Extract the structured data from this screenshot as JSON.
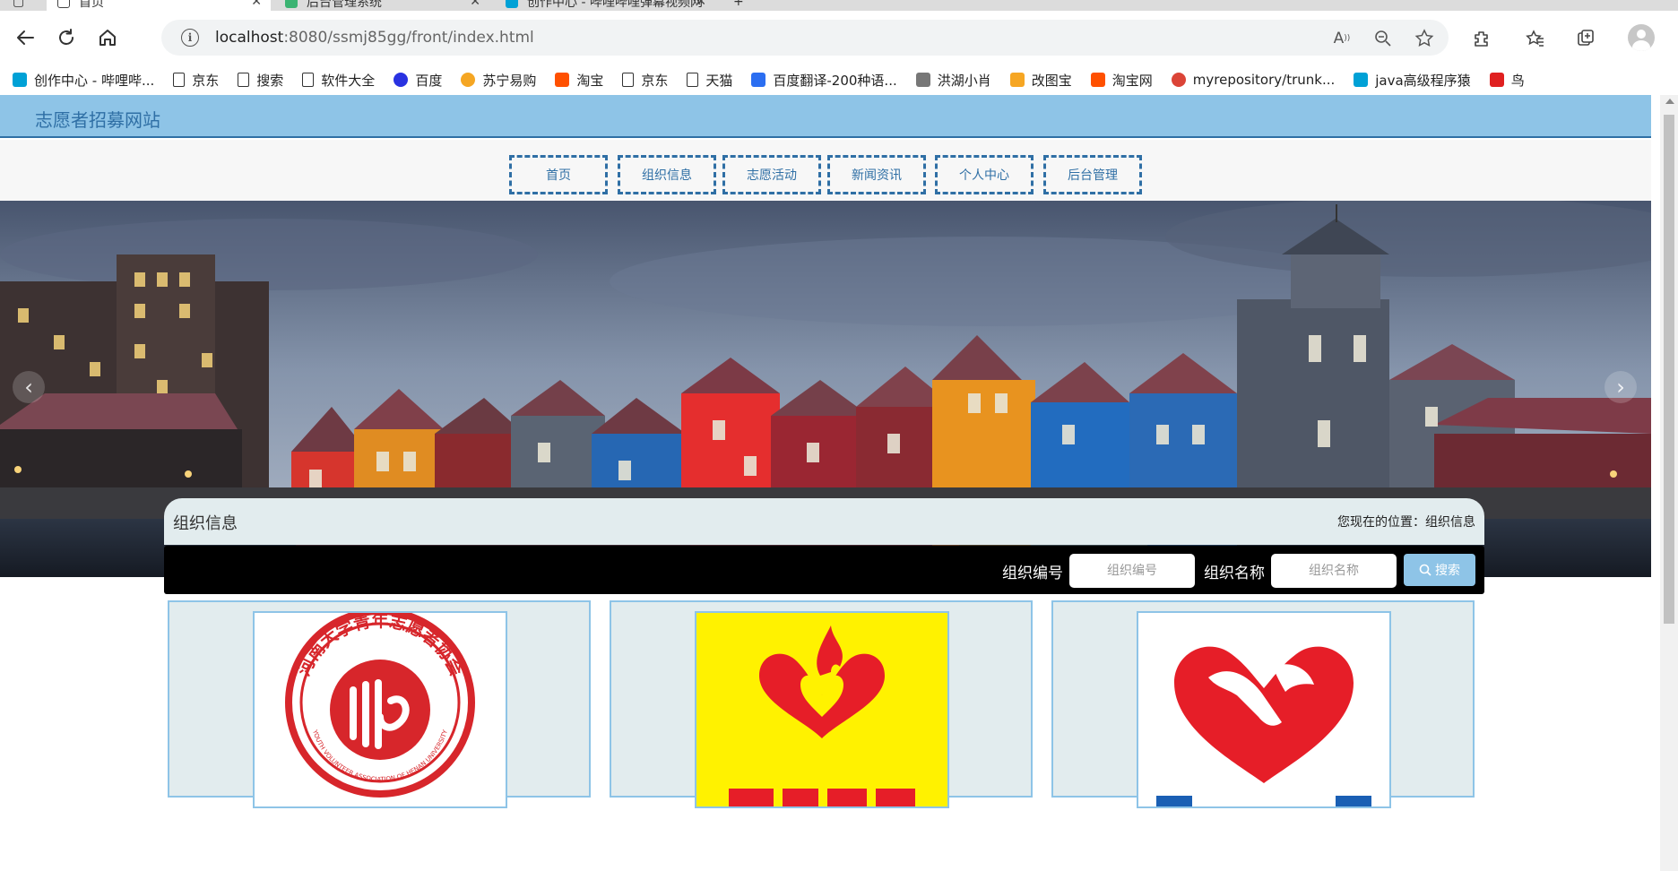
{
  "browser": {
    "tabs": [
      {
        "label": "首页",
        "active": true
      },
      {
        "label": "后台管理系统",
        "active": false
      },
      {
        "label": "创作中心 - 哔哩哔哩弹幕视频网",
        "active": false
      }
    ],
    "url": {
      "host": "localhost",
      "rest": ":8080/ssmj85gg/front/index.html"
    },
    "bookmarks": [
      {
        "label": "创作中心 - 哔哩哔...",
        "icon": "bilibili-icon",
        "color": "#00a1d6"
      },
      {
        "label": "京东",
        "icon": "page-icon"
      },
      {
        "label": "搜索",
        "icon": "page-icon"
      },
      {
        "label": "软件大全",
        "icon": "page-icon"
      },
      {
        "label": "百度",
        "icon": "baidu-paw-icon",
        "color": "#2932e1"
      },
      {
        "label": "苏宁易购",
        "icon": "suning-icon",
        "color": "#f5a623"
      },
      {
        "label": "淘宝",
        "icon": "taobao-icon",
        "color": "#ff5000"
      },
      {
        "label": "京东",
        "icon": "page-icon"
      },
      {
        "label": "天猫",
        "icon": "page-icon"
      },
      {
        "label": "百度翻译-200种语...",
        "icon": "translate-icon",
        "color": "#2b6ef1"
      },
      {
        "label": "洪湖小肖",
        "icon": "bird-icon",
        "color": "#777777"
      },
      {
        "label": "改图宝",
        "icon": "gaitubao-icon",
        "color": "#f6a623"
      },
      {
        "label": "淘宝网",
        "icon": "taobao-icon",
        "color": "#ff5000"
      },
      {
        "label": "myrepository/trunk...",
        "icon": "chrome-icon",
        "color": "#db4437"
      },
      {
        "label": "java高级程序猿",
        "icon": "bilibili-icon",
        "color": "#00a1d6"
      },
      {
        "label": "鸟",
        "icon": "bird-icon",
        "color": "#e02020"
      }
    ]
  },
  "site": {
    "title": "志愿者招募网站",
    "nav": [
      "首页",
      "组织信息",
      "志愿活动",
      "新闻资讯",
      "个人中心",
      "后台管理"
    ],
    "colors": {
      "accent": "#8ec4e7",
      "border": "#2f6fa5",
      "section_bg": "#e2ecee"
    }
  },
  "carousel": {
    "slides": 3,
    "active": 0,
    "prev_icon": "‹",
    "next_icon": "›"
  },
  "section": {
    "title": "组织信息",
    "breadcrumb": "您现在的位置：组织信息"
  },
  "search": {
    "fields": [
      {
        "label": "组织编号",
        "placeholder": "组织编号"
      },
      {
        "label": "组织名称",
        "placeholder": "组织名称"
      }
    ],
    "button_label": "搜索"
  },
  "cards": [
    {
      "logo": "henan-university-youth-volunteer-association-logo",
      "logo_text": "河南大学青年志愿者协会",
      "logo_text_en": "YOUTH VOLUNTEER ASSOCIATION OF HENAN UNIVERSITY"
    },
    {
      "logo": "red-heart-flame-logo"
    },
    {
      "logo": "red-heart-hand-dove-logo"
    }
  ]
}
